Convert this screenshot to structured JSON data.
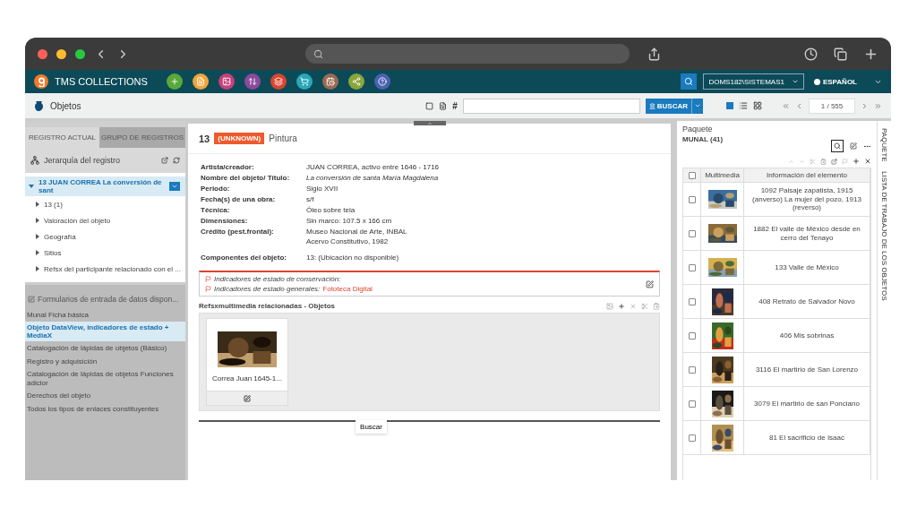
{
  "app": {
    "title": "TMS COLLECTIONS",
    "toolbar_buttons": [
      {
        "color": "#5aa83a"
      },
      {
        "color": "#f0a63c"
      },
      {
        "color": "#c8407a"
      },
      {
        "color": "#8a4a9c"
      },
      {
        "color": "#d9452f"
      },
      {
        "color": "#2aa7b8"
      },
      {
        "color": "#9a6a52"
      },
      {
        "color": "#8aa53a"
      },
      {
        "color": "#4a62b0"
      }
    ],
    "user": "DOMS182\\SISTEMAS1",
    "language": "ESPAÑOL"
  },
  "module": {
    "title": "Objetos",
    "search_button": "BUSCAR",
    "hash": "#",
    "pager": "1 / 555"
  },
  "left": {
    "tabs": [
      {
        "label": "REGISTRO ACTUAL",
        "selected": true
      },
      {
        "label": "GRUPO DE REGISTROS",
        "selected": false
      }
    ],
    "hierarchy_title": "Jerarquía del registro",
    "tree": {
      "label": "13 JUAN CORREA La conversión de sant",
      "expanded": true,
      "children": [
        {
          "label": "13 (1)",
          "expanded": false
        },
        {
          "label": "Valoración del objeto",
          "expanded": false
        },
        {
          "label": "Geografía",
          "expanded": false
        },
        {
          "label": "Sitios",
          "expanded": false
        },
        {
          "label": "Refsx del participante relacionado con el ...",
          "expanded": false
        }
      ]
    },
    "forms_title": "Formularios de entrada de datos dispon...",
    "forms": [
      {
        "label": "Munal Ficha básica",
        "selected": false
      },
      {
        "label": "Objeto DataView, indicadores de estado + MediaX",
        "selected": true
      },
      {
        "label": "Catalogación de lápidas de objetos (Básico)",
        "selected": false
      },
      {
        "label": "Registro y adquisición",
        "selected": false
      },
      {
        "label": "Catalogación de lápidas de objetos Funciones adicior",
        "selected": false
      },
      {
        "label": "Derechos del objeto",
        "selected": false
      },
      {
        "label": "Todos los tipos de enlaces constituyentes",
        "selected": false
      }
    ]
  },
  "record": {
    "number": "13",
    "badge": "(UNKNOWN)",
    "type": "Pintura",
    "fields": [
      {
        "label": "Artista/creador:",
        "values": [
          "JUAN CORREA, activo entre 1646 - 1716"
        ],
        "italic": false
      },
      {
        "label": "Nombre del objeto/ Título:",
        "values": [
          "La conversión de santa María Magdalena"
        ],
        "italic": true
      },
      {
        "label": "Periodo:",
        "values": [
          "Siglo XVII"
        ],
        "italic": false
      },
      {
        "label": "Fecha(s) de una obra:",
        "values": [
          "s/f"
        ],
        "italic": false
      },
      {
        "label": "Técnica:",
        "values": [
          "Óleo sobre tela"
        ],
        "italic": false
      },
      {
        "label": "Dimensiones:",
        "values": [
          "Sin marco: 107.5 x 166 cm"
        ],
        "italic": false
      },
      {
        "label": "Crédito (pest.frontal):",
        "values": [
          "Museo Nacional de Arte, INBAL",
          "Acervo Constitutivo, 1982"
        ],
        "italic": false
      }
    ],
    "components": {
      "label": "Componentes del objeto:",
      "value": "13: (Ubicación no disponible)"
    },
    "indicators": [
      {
        "label": "Indicadores de estado de conservación:"
      },
      {
        "label": "Indicadores de estado generales:",
        "link": "Fototeca Digital"
      }
    ],
    "media_title": "Refsxmultimedia relacionadas - Objetos",
    "media": [
      {
        "caption": "Correa Juan 1645-1..."
      }
    ],
    "bottom_tab": "Buscar"
  },
  "right": {
    "title": "Paquete",
    "package": "MUNAL (41)",
    "select_all_checked": false,
    "columns": [
      "Multimedia",
      "Información del elemento"
    ],
    "rows": [
      {
        "checked": false,
        "text": "1092 Paisaje zapatista, 1915 (anverso) La mujer del pozo, 1913 (reverso)"
      },
      {
        "checked": false,
        "text": "1882 El valle de México desde en cerro del Tenayo"
      },
      {
        "checked": false,
        "text": "133 Valle de México"
      },
      {
        "checked": false,
        "text": "408 Retrato de Salvador Novo"
      },
      {
        "checked": false,
        "text": "406 Mis sobrinas"
      },
      {
        "checked": false,
        "text": "3116 El martirio de San Lorenzo"
      },
      {
        "checked": false,
        "text": "3079 El martirio de san Ponciano"
      },
      {
        "checked": false,
        "text": "81 El sacrificio de Isaac"
      }
    ],
    "side_tabs": [
      "PAQUETE",
      "LISTA DE TRABAJO DE LOS OBJETOS"
    ]
  }
}
